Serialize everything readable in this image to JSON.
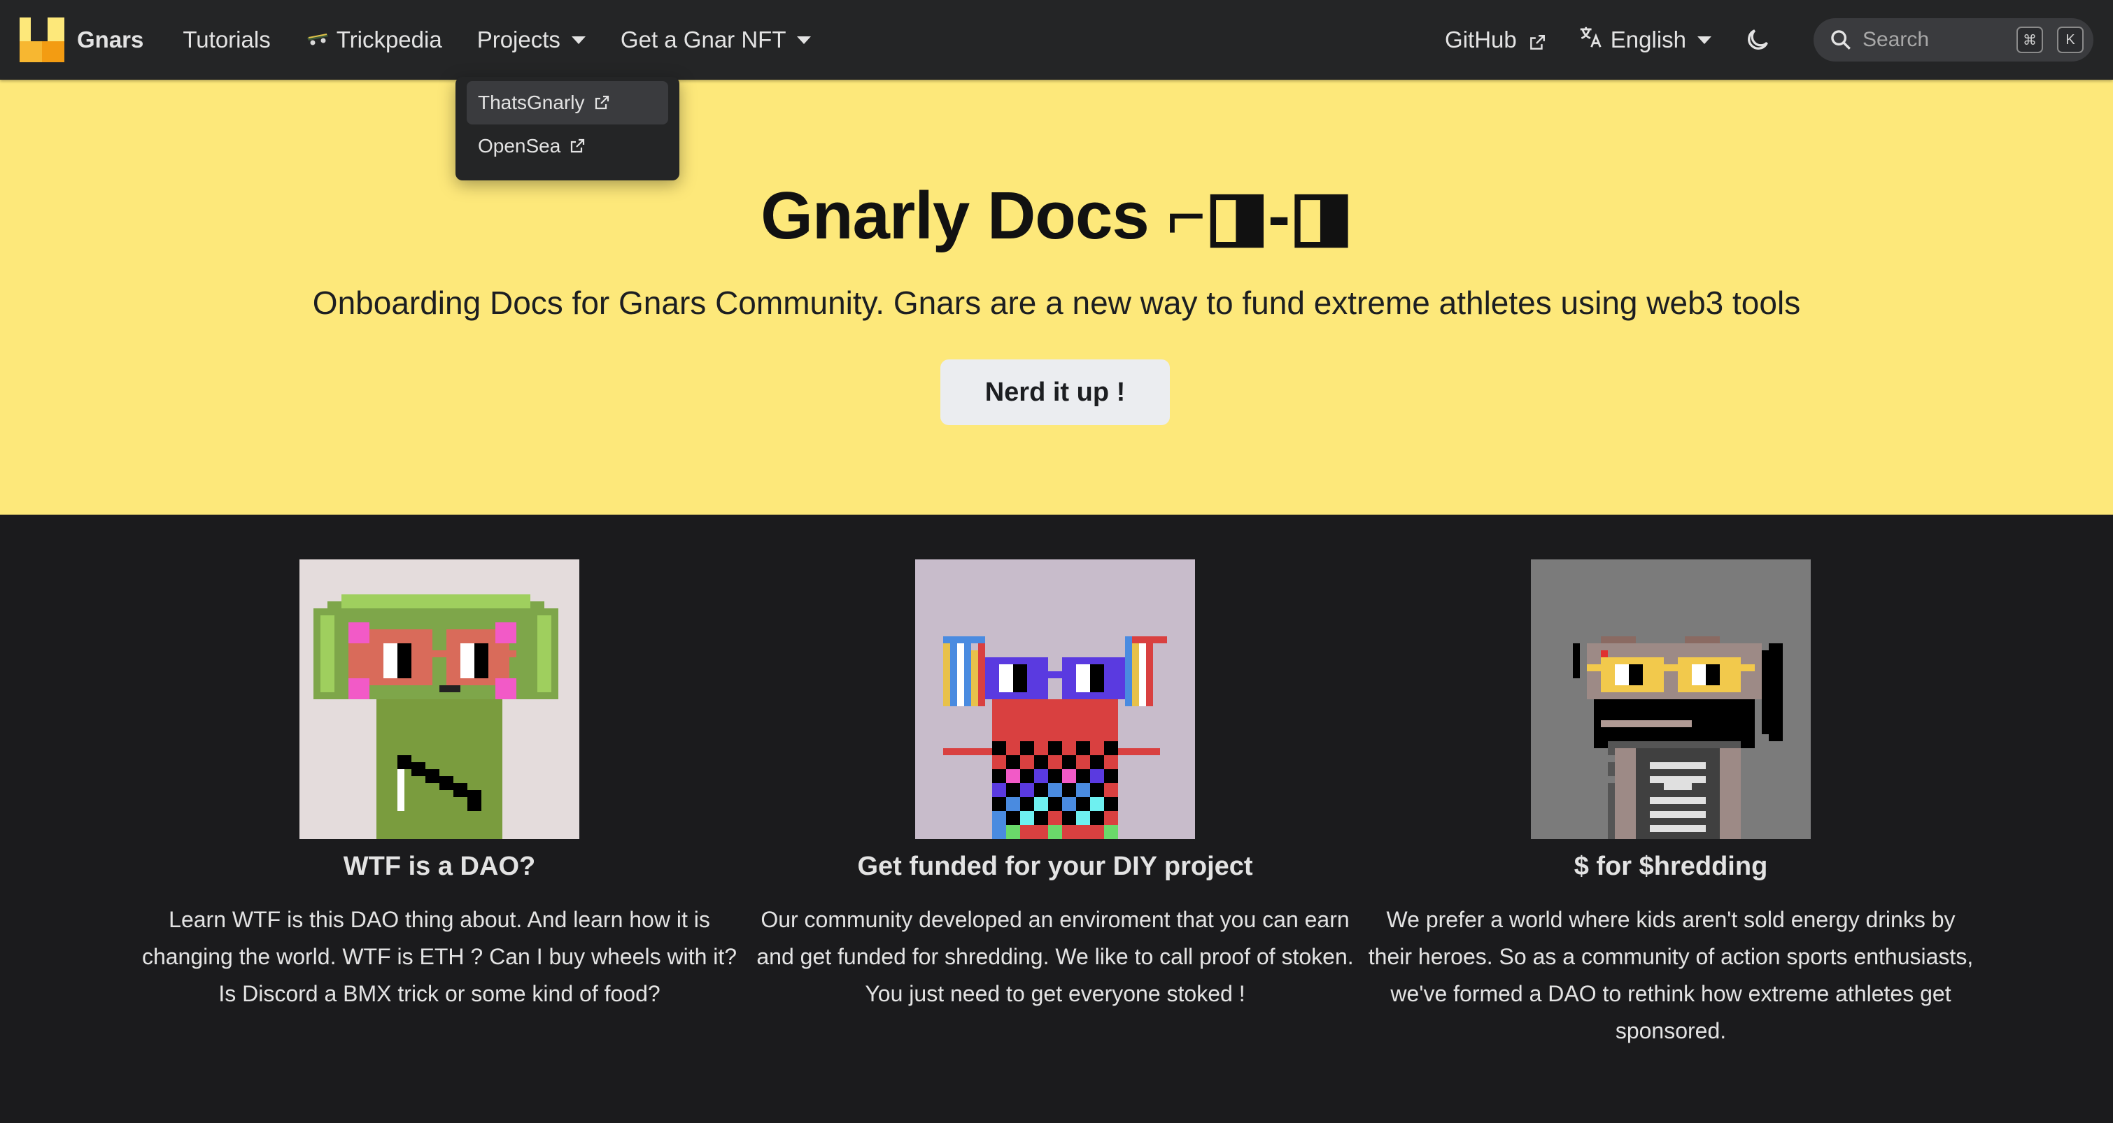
{
  "navbar": {
    "brand": "Gnars",
    "items": [
      {
        "label": "Tutorials"
      },
      {
        "label": "Trickpedia"
      },
      {
        "label": "Projects"
      },
      {
        "label": "Get a Gnar NFT"
      }
    ],
    "github": "GitHub",
    "language": "English",
    "search_placeholder": "Search",
    "search_keys": [
      "⌘",
      "K"
    ]
  },
  "projects_dropdown": {
    "items": [
      {
        "label": "ThatsGnarly"
      },
      {
        "label": "OpenSea"
      }
    ]
  },
  "hero": {
    "title": "Gnarly Docs ⌐◨-◨",
    "subtitle": "Onboarding Docs for Gnars Community. Gnars are a new way to fund extreme athletes using web3 tools",
    "button": "Nerd it up !"
  },
  "features": [
    {
      "title": "WTF is a DAO?",
      "text": "Learn WTF is this DAO thing about. And learn how it is changing the world. WTF is ETH ? Can I buy wheels with it? Is Discord a BMX trick or some kind of food?"
    },
    {
      "title": "Get funded for your DIY project",
      "text": "Our community developed an enviroment that you can earn and get funded for shredding. We like to call proof of stoken. You just need to get everyone stoked !"
    },
    {
      "title": "$ for $hredding",
      "text": "We prefer a world where kids aren't sold energy drinks by their heroes. So as a community of action sports enthusiasts, we've formed a DAO to rethink how extreme athletes get sponsored."
    }
  ],
  "colors": {
    "navbar_bg": "#242526",
    "hero_bg": "#fde87a",
    "page_bg": "#1b1b1d"
  }
}
